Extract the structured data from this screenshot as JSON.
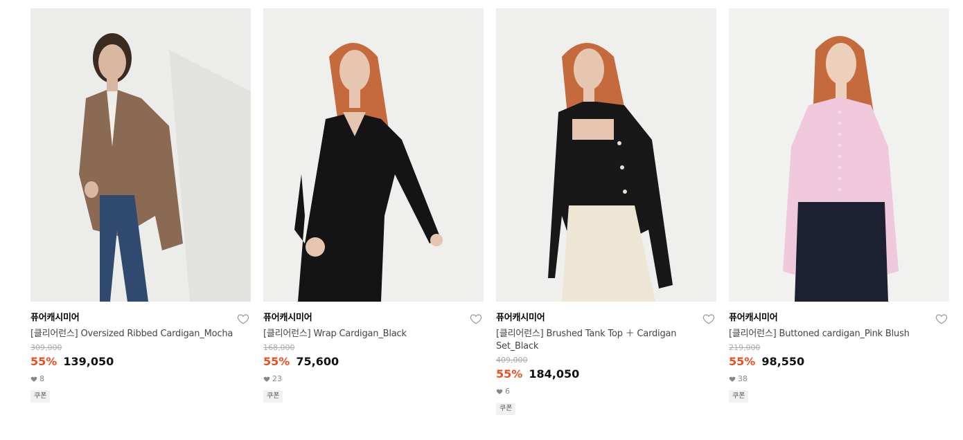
{
  "products": [
    {
      "brand": "퓨어캐시미어",
      "name": "[클리어런스] Oversized Ribbed Cardigan_Mocha",
      "original_price": "309,000",
      "discount_rate": "55%",
      "sale_price": "139,050",
      "likes": "8",
      "badge": "쿠폰",
      "image": {
        "background": "#ececea",
        "garment": "#8a6a52",
        "inner": "#f3efe8",
        "bottom": "#2f4a6e",
        "hair": "#3a2a20"
      }
    },
    {
      "brand": "퓨어캐시미어",
      "name": "[클리어런스] Wrap Cardigan_Black",
      "original_price": "168,000",
      "discount_rate": "55%",
      "sale_price": "75,600",
      "likes": "23",
      "badge": "쿠폰",
      "image": {
        "background": "#efefed",
        "garment": "#141414",
        "inner": "#141414",
        "bottom": "#141414",
        "hair": "#c56a3c"
      }
    },
    {
      "brand": "퓨어캐시미어",
      "name": "[클리어런스] Brushed Tank Top ＋ Cardigan Set_Black",
      "original_price": "409,000",
      "discount_rate": "55%",
      "sale_price": "184,050",
      "likes": "6",
      "badge": "쿠폰",
      "image": {
        "background": "#efefed",
        "garment": "#181818",
        "inner": "#1e1e1e",
        "bottom": "#eee6d4",
        "hair": "#c56a3c"
      }
    },
    {
      "brand": "퓨어캐시미어",
      "name": "[클리어런스] Buttoned cardigan_Pink Blush",
      "original_price": "219,000",
      "discount_rate": "55%",
      "sale_price": "98,550",
      "likes": "38",
      "badge": "쿠폰",
      "image": {
        "background": "#f1f1ef",
        "garment": "#efc8dc",
        "inner": "#efc8dc",
        "bottom": "#1c2030",
        "hair": "#c56a3c"
      }
    }
  ],
  "icons": {
    "wishlist": "heart-outline-icon",
    "likes": "heart-filled-icon"
  },
  "colors": {
    "discount": "#f04e1e",
    "original_price": "#aaaaaa",
    "badge_bg": "#f1f1f1"
  }
}
